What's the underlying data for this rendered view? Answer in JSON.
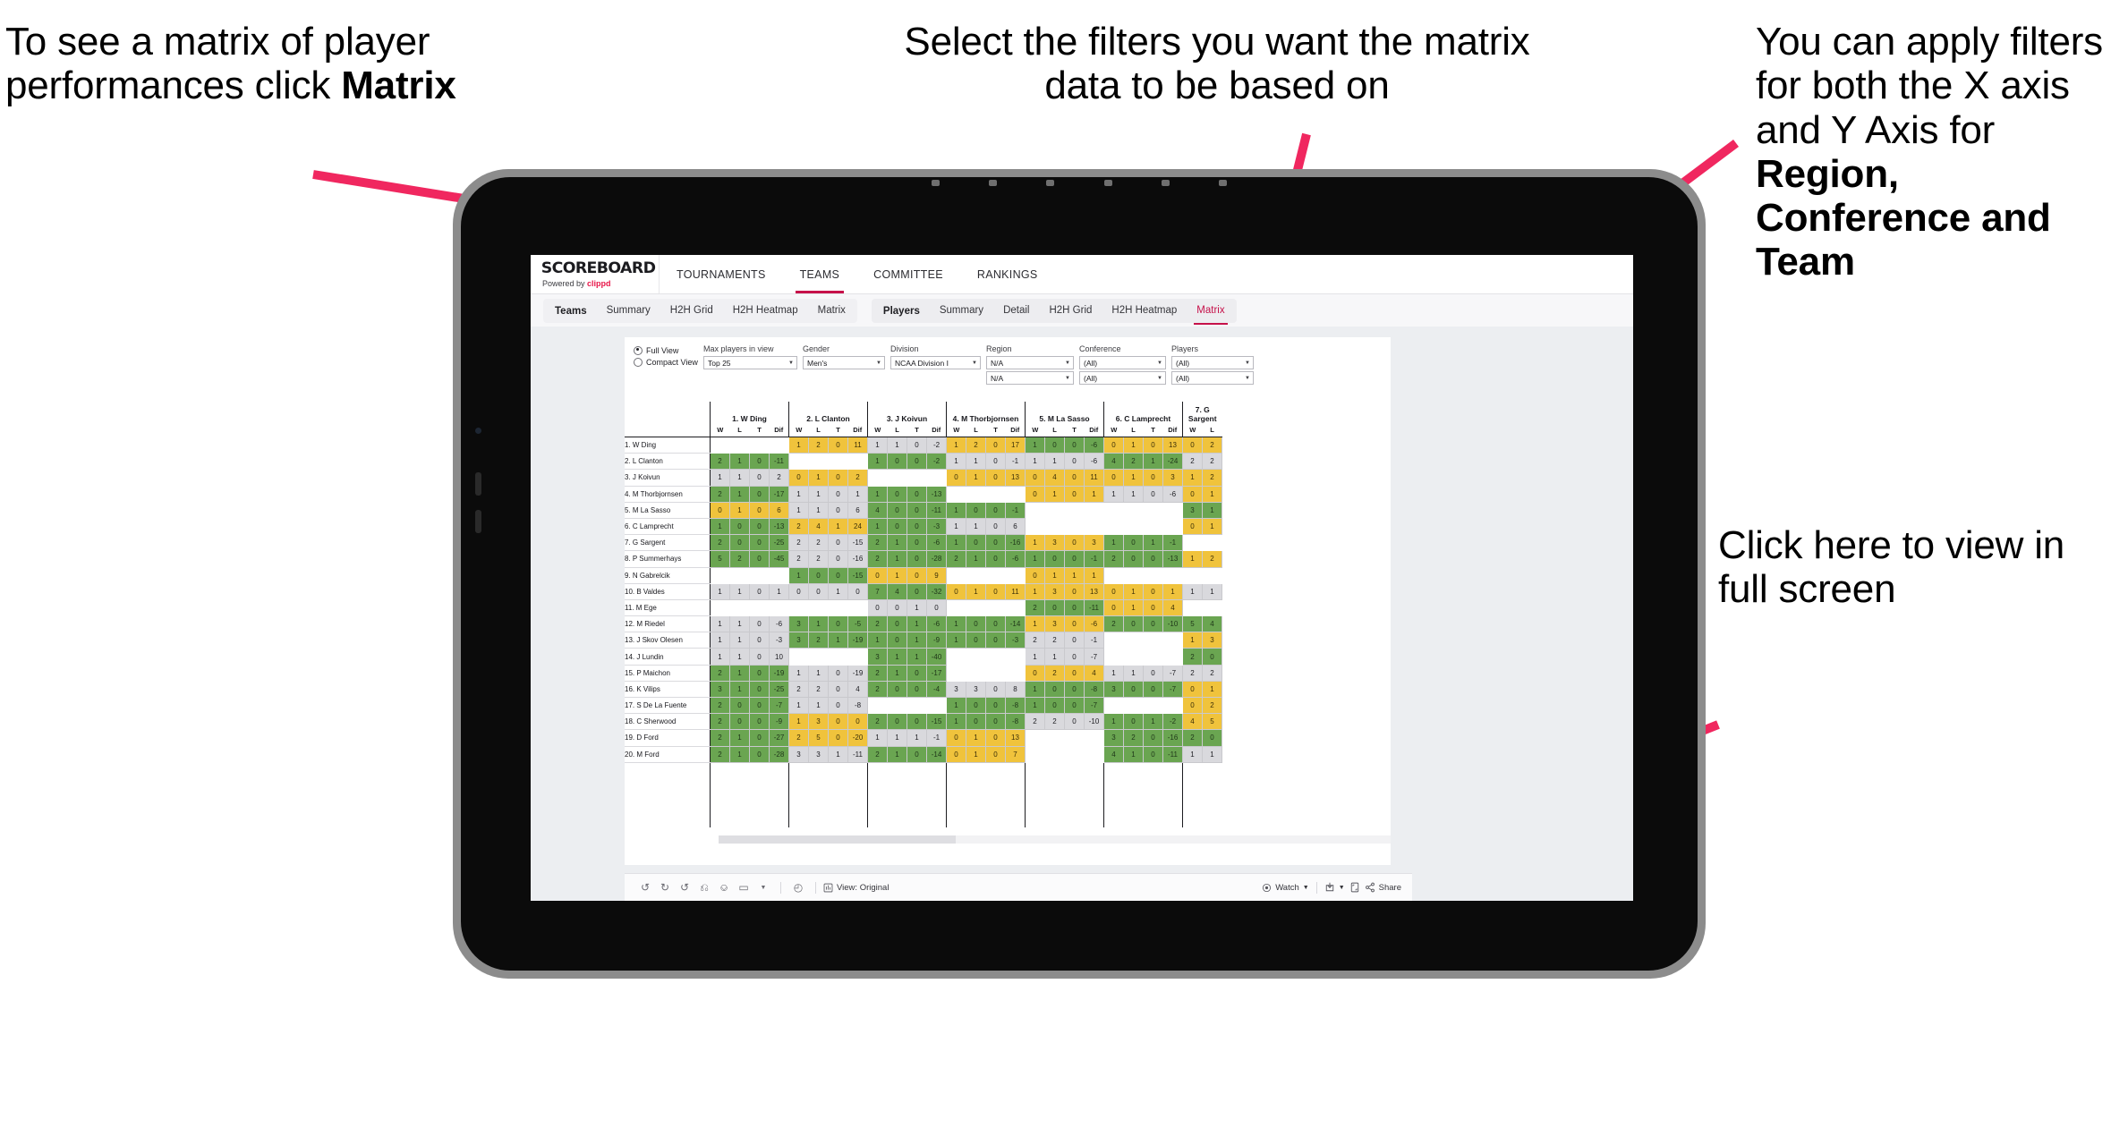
{
  "annotations": {
    "matrix_tip": {
      "pre": "To see a matrix of player performances click ",
      "bold": "Matrix"
    },
    "filters_tip": {
      "text": "Select the filters you want the matrix data to be based on"
    },
    "axis_tip": {
      "pre": "You  can apply filters for both the X axis and Y Axis for ",
      "bold": "Region, Conference and Team"
    },
    "fullscreen_tip": {
      "text": "Click here to view in full screen"
    }
  },
  "colors": {
    "accent_pink": "#e8174a",
    "tab_active": "#c6114a",
    "arrow": "#f0275f",
    "win_green": "#6aa551",
    "tie_yellow": "#f0c33c",
    "loss_grey": "#d9d9dd",
    "device_frame": "#8c8c8c",
    "device_body": "#0b0b0b"
  },
  "app": {
    "brand": {
      "name": "SCOREBOARD",
      "tagline_pre": "Powered by ",
      "tagline_brand": "clippd"
    },
    "top_nav": [
      {
        "label": "TOURNAMENTS",
        "active": false
      },
      {
        "label": "TEAMS",
        "active": true
      },
      {
        "label": "COMMITTEE",
        "active": false
      },
      {
        "label": "RANKINGS",
        "active": false
      }
    ],
    "sub_nav": {
      "teams_group": {
        "lead": "Teams",
        "items": [
          {
            "label": "Summary",
            "active": false
          },
          {
            "label": "H2H Grid",
            "active": false
          },
          {
            "label": "H2H Heatmap",
            "active": false
          },
          {
            "label": "Matrix",
            "active": false
          }
        ]
      },
      "players_group": {
        "lead": "Players",
        "items": [
          {
            "label": "Summary",
            "active": false
          },
          {
            "label": "Detail",
            "active": false
          },
          {
            "label": "H2H Grid",
            "active": false
          },
          {
            "label": "H2H Heatmap",
            "active": false
          },
          {
            "label": "Matrix",
            "active": true
          }
        ]
      }
    }
  },
  "filters": {
    "view_mode": {
      "full": "Full View",
      "compact": "Compact View",
      "selected": "Full View"
    },
    "controls": [
      {
        "label": "Max players in view",
        "value": "Top 25"
      },
      {
        "label": "Gender",
        "value": "Men's"
      },
      {
        "label": "Division",
        "value": "NCAA Division I"
      }
    ],
    "axis_controls": [
      {
        "label": "Region",
        "x_value": "N/A",
        "y_value": "N/A"
      },
      {
        "label": "Conference",
        "x_value": "(All)",
        "y_value": "(All)"
      },
      {
        "label": "Players",
        "x_value": "(All)",
        "y_value": "(All)"
      }
    ]
  },
  "chart_data": {
    "type": "table",
    "title": "Player head-to-head matrix",
    "sub_headers": [
      "W",
      "L",
      "T",
      "Dif"
    ],
    "columns": [
      "1. W Ding",
      "2. L Clanton",
      "3. J Koivun",
      "4. M Thorbjornsen",
      "5. M La Sasso",
      "6. C Lamprecht",
      "7. G Sargent"
    ],
    "last_column_partial_subs": [
      "W",
      "L"
    ],
    "rows": [
      "1. W Ding",
      "2. L Clanton",
      "3. J Koivun",
      "4. M Thorbjornsen",
      "5. M La Sasso",
      "6. C Lamprecht",
      "7. G Sargent",
      "8. P Summerhays",
      "9. N Gabrelcik",
      "10. B Valdes",
      "11. M Ege",
      "12. M Riedel",
      "13. J Skov Olesen",
      "14. J Lundin",
      "15. P Maichon",
      "16. K Vilips",
      "17. S De La Fuente",
      "18. C Sherwood",
      "19. D Ford",
      "20. M Ford"
    ],
    "cells": [
      [
        {
          "t": "e"
        },
        {
          "t": "y",
          "v": [
            1,
            2,
            0,
            11
          ]
        },
        {
          "t": "n",
          "v": [
            1,
            1,
            0,
            -2
          ]
        },
        {
          "t": "y",
          "v": [
            1,
            2,
            0,
            17
          ]
        },
        {
          "t": "g",
          "v": [
            1,
            0,
            0,
            -6
          ]
        },
        {
          "t": "y",
          "v": [
            0,
            1,
            0,
            13
          ]
        },
        {
          "t": "y",
          "v": [
            0,
            2
          ]
        }
      ],
      [
        {
          "t": "g",
          "v": [
            2,
            1,
            0,
            -11
          ]
        },
        {
          "t": "e"
        },
        {
          "t": "g",
          "v": [
            1,
            0,
            0,
            -2
          ]
        },
        {
          "t": "n",
          "v": [
            1,
            1,
            0,
            -1
          ]
        },
        {
          "t": "n",
          "v": [
            1,
            1,
            0,
            -6
          ]
        },
        {
          "t": "g",
          "v": [
            4,
            2,
            1,
            -24
          ]
        },
        {
          "t": "n",
          "v": [
            2,
            2
          ]
        }
      ],
      [
        {
          "t": "n",
          "v": [
            1,
            1,
            0,
            2
          ]
        },
        {
          "t": "y",
          "v": [
            0,
            1,
            0,
            2
          ]
        },
        {
          "t": "e"
        },
        {
          "t": "y",
          "v": [
            0,
            1,
            0,
            13
          ]
        },
        {
          "t": "y",
          "v": [
            0,
            4,
            0,
            11
          ]
        },
        {
          "t": "y",
          "v": [
            0,
            1,
            0,
            3
          ]
        },
        {
          "t": "y",
          "v": [
            1,
            2
          ]
        }
      ],
      [
        {
          "t": "g",
          "v": [
            2,
            1,
            0,
            -17
          ]
        },
        {
          "t": "n",
          "v": [
            1,
            1,
            0,
            1
          ]
        },
        {
          "t": "g",
          "v": [
            1,
            0,
            0,
            -13
          ]
        },
        {
          "t": "e"
        },
        {
          "t": "y",
          "v": [
            0,
            1,
            0,
            1
          ]
        },
        {
          "t": "n",
          "v": [
            1,
            1,
            0,
            -6
          ]
        },
        {
          "t": "y",
          "v": [
            0,
            1
          ]
        }
      ],
      [
        {
          "t": "y",
          "v": [
            0,
            1,
            0,
            6
          ]
        },
        {
          "t": "n",
          "v": [
            1,
            1,
            0,
            6
          ]
        },
        {
          "t": "g",
          "v": [
            4,
            0,
            0,
            -11
          ]
        },
        {
          "t": "g",
          "v": [
            1,
            0,
            0,
            -1
          ]
        },
        {
          "t": "e"
        },
        {
          "t": "e"
        },
        {
          "t": "g",
          "v": [
            3,
            1
          ]
        }
      ],
      [
        {
          "t": "g",
          "v": [
            1,
            0,
            0,
            -13
          ]
        },
        {
          "t": "y",
          "v": [
            2,
            4,
            1,
            24
          ]
        },
        {
          "t": "g",
          "v": [
            1,
            0,
            0,
            -3
          ]
        },
        {
          "t": "n",
          "v": [
            1,
            1,
            0,
            6
          ]
        },
        {
          "t": "e"
        },
        {
          "t": "e"
        },
        {
          "t": "y",
          "v": [
            0,
            1
          ]
        }
      ],
      [
        {
          "t": "g",
          "v": [
            2,
            0,
            0,
            -25
          ]
        },
        {
          "t": "n",
          "v": [
            2,
            2,
            0,
            -15
          ]
        },
        {
          "t": "g",
          "v": [
            2,
            1,
            0,
            -6
          ]
        },
        {
          "t": "g",
          "v": [
            1,
            0,
            0,
            -16
          ]
        },
        {
          "t": "y",
          "v": [
            1,
            3,
            0,
            3
          ]
        },
        {
          "t": "g",
          "v": [
            1,
            0,
            1,
            -1
          ]
        },
        {
          "t": "e"
        }
      ],
      [
        {
          "t": "g",
          "v": [
            5,
            2,
            0,
            -45
          ]
        },
        {
          "t": "n",
          "v": [
            2,
            2,
            0,
            -16
          ]
        },
        {
          "t": "g",
          "v": [
            2,
            1,
            0,
            -28
          ]
        },
        {
          "t": "g",
          "v": [
            2,
            1,
            0,
            -6
          ]
        },
        {
          "t": "g",
          "v": [
            1,
            0,
            0,
            -1
          ]
        },
        {
          "t": "g",
          "v": [
            2,
            0,
            0,
            -13
          ]
        },
        {
          "t": "y",
          "v": [
            1,
            2
          ]
        }
      ],
      [
        {
          "t": "e"
        },
        {
          "t": "g",
          "v": [
            1,
            0,
            0,
            -15
          ]
        },
        {
          "t": "y",
          "v": [
            0,
            1,
            0,
            9
          ]
        },
        {
          "t": "e"
        },
        {
          "t": "y",
          "v": [
            0,
            1,
            1,
            1
          ]
        },
        {
          "t": "e"
        },
        {
          "t": "e"
        }
      ],
      [
        {
          "t": "n",
          "v": [
            1,
            1,
            0,
            1
          ]
        },
        {
          "t": "n",
          "v": [
            0,
            0,
            1,
            0
          ]
        },
        {
          "t": "g",
          "v": [
            7,
            4,
            0,
            -32
          ]
        },
        {
          "t": "y",
          "v": [
            0,
            1,
            0,
            11
          ]
        },
        {
          "t": "y",
          "v": [
            1,
            3,
            0,
            13
          ]
        },
        {
          "t": "y",
          "v": [
            0,
            1,
            0,
            1
          ]
        },
        {
          "t": "n",
          "v": [
            1,
            1
          ]
        }
      ],
      [
        {
          "t": "e"
        },
        {
          "t": "e"
        },
        {
          "t": "n",
          "v": [
            0,
            0,
            1,
            0
          ]
        },
        {
          "t": "e"
        },
        {
          "t": "g",
          "v": [
            2,
            0,
            0,
            -11
          ]
        },
        {
          "t": "y",
          "v": [
            0,
            1,
            0,
            4
          ]
        },
        {
          "t": "e"
        }
      ],
      [
        {
          "t": "n",
          "v": [
            1,
            1,
            0,
            -6
          ]
        },
        {
          "t": "g",
          "v": [
            3,
            1,
            0,
            -5
          ]
        },
        {
          "t": "g",
          "v": [
            2,
            0,
            1,
            -6
          ]
        },
        {
          "t": "g",
          "v": [
            1,
            0,
            0,
            -14
          ]
        },
        {
          "t": "y",
          "v": [
            1,
            3,
            0,
            -6
          ]
        },
        {
          "t": "g",
          "v": [
            2,
            0,
            0,
            -10
          ]
        },
        {
          "t": "g",
          "v": [
            5,
            4
          ]
        }
      ],
      [
        {
          "t": "n",
          "v": [
            1,
            1,
            0,
            -3
          ]
        },
        {
          "t": "g",
          "v": [
            3,
            2,
            1,
            -19
          ]
        },
        {
          "t": "g",
          "v": [
            1,
            0,
            1,
            -9
          ]
        },
        {
          "t": "g",
          "v": [
            1,
            0,
            0,
            -3
          ]
        },
        {
          "t": "n",
          "v": [
            2,
            2,
            0,
            -1
          ]
        },
        {
          "t": "e"
        },
        {
          "t": "y",
          "v": [
            1,
            3
          ]
        }
      ],
      [
        {
          "t": "n",
          "v": [
            1,
            1,
            0,
            10
          ]
        },
        {
          "t": "e"
        },
        {
          "t": "g",
          "v": [
            3,
            1,
            1,
            -40
          ]
        },
        {
          "t": "e"
        },
        {
          "t": "n",
          "v": [
            1,
            1,
            0,
            -7
          ]
        },
        {
          "t": "e"
        },
        {
          "t": "g",
          "v": [
            2,
            0
          ]
        }
      ],
      [
        {
          "t": "g",
          "v": [
            2,
            1,
            0,
            -19
          ]
        },
        {
          "t": "n",
          "v": [
            1,
            1,
            0,
            -19
          ]
        },
        {
          "t": "g",
          "v": [
            2,
            1,
            0,
            -17
          ]
        },
        {
          "t": "e"
        },
        {
          "t": "y",
          "v": [
            0,
            2,
            0,
            4
          ]
        },
        {
          "t": "n",
          "v": [
            1,
            1,
            0,
            -7
          ]
        },
        {
          "t": "n",
          "v": [
            2,
            2
          ]
        }
      ],
      [
        {
          "t": "g",
          "v": [
            3,
            1,
            0,
            -25
          ]
        },
        {
          "t": "n",
          "v": [
            2,
            2,
            0,
            4
          ]
        },
        {
          "t": "g",
          "v": [
            2,
            0,
            0,
            -4
          ]
        },
        {
          "t": "n",
          "v": [
            3,
            3,
            0,
            8
          ]
        },
        {
          "t": "g",
          "v": [
            1,
            0,
            0,
            -8
          ]
        },
        {
          "t": "g",
          "v": [
            3,
            0,
            0,
            -7
          ]
        },
        {
          "t": "y",
          "v": [
            0,
            1
          ]
        }
      ],
      [
        {
          "t": "g",
          "v": [
            2,
            0,
            0,
            -7
          ]
        },
        {
          "t": "n",
          "v": [
            1,
            1,
            0,
            -8
          ]
        },
        {
          "t": "e"
        },
        {
          "t": "g",
          "v": [
            1,
            0,
            0,
            -8
          ]
        },
        {
          "t": "g",
          "v": [
            1,
            0,
            0,
            -7
          ]
        },
        {
          "t": "e"
        },
        {
          "t": "y",
          "v": [
            0,
            2
          ]
        }
      ],
      [
        {
          "t": "g",
          "v": [
            2,
            0,
            0,
            -9
          ]
        },
        {
          "t": "y",
          "v": [
            1,
            3,
            0,
            0
          ]
        },
        {
          "t": "g",
          "v": [
            2,
            0,
            0,
            -15
          ]
        },
        {
          "t": "g",
          "v": [
            1,
            0,
            0,
            -8
          ]
        },
        {
          "t": "n",
          "v": [
            2,
            2,
            0,
            -10
          ]
        },
        {
          "t": "g",
          "v": [
            1,
            0,
            1,
            -2
          ]
        },
        {
          "t": "y",
          "v": [
            4,
            5
          ]
        }
      ],
      [
        {
          "t": "g",
          "v": [
            2,
            1,
            0,
            -27
          ]
        },
        {
          "t": "y",
          "v": [
            2,
            5,
            0,
            -20
          ]
        },
        {
          "t": "n",
          "v": [
            1,
            1,
            1,
            -1
          ]
        },
        {
          "t": "y",
          "v": [
            0,
            1,
            0,
            13
          ]
        },
        {
          "t": "e"
        },
        {
          "t": "g",
          "v": [
            3,
            2,
            0,
            -16
          ]
        },
        {
          "t": "g",
          "v": [
            2,
            0
          ]
        }
      ],
      [
        {
          "t": "g",
          "v": [
            2,
            1,
            0,
            -28
          ]
        },
        {
          "t": "n",
          "v": [
            3,
            3,
            1,
            -11
          ]
        },
        {
          "t": "g",
          "v": [
            2,
            1,
            0,
            -14
          ]
        },
        {
          "t": "y",
          "v": [
            0,
            1,
            0,
            7
          ]
        },
        {
          "t": "e"
        },
        {
          "t": "g",
          "v": [
            4,
            1,
            0,
            -11
          ]
        },
        {
          "t": "n",
          "v": [
            1,
            1
          ]
        }
      ]
    ]
  },
  "bottom_toolbar": {
    "icons": [
      "undo-icon",
      "redo-icon",
      "revert-icon",
      "refresh-icon",
      "pause-icon",
      "shape-icon",
      "dropdown-caret-icon",
      "alerts-icon"
    ],
    "view_label": "View: Original",
    "watch_label": "Watch",
    "share_label": "Share",
    "device_icon": "device-preview-icon",
    "fullscreen_icon": "fullscreen-icon"
  }
}
